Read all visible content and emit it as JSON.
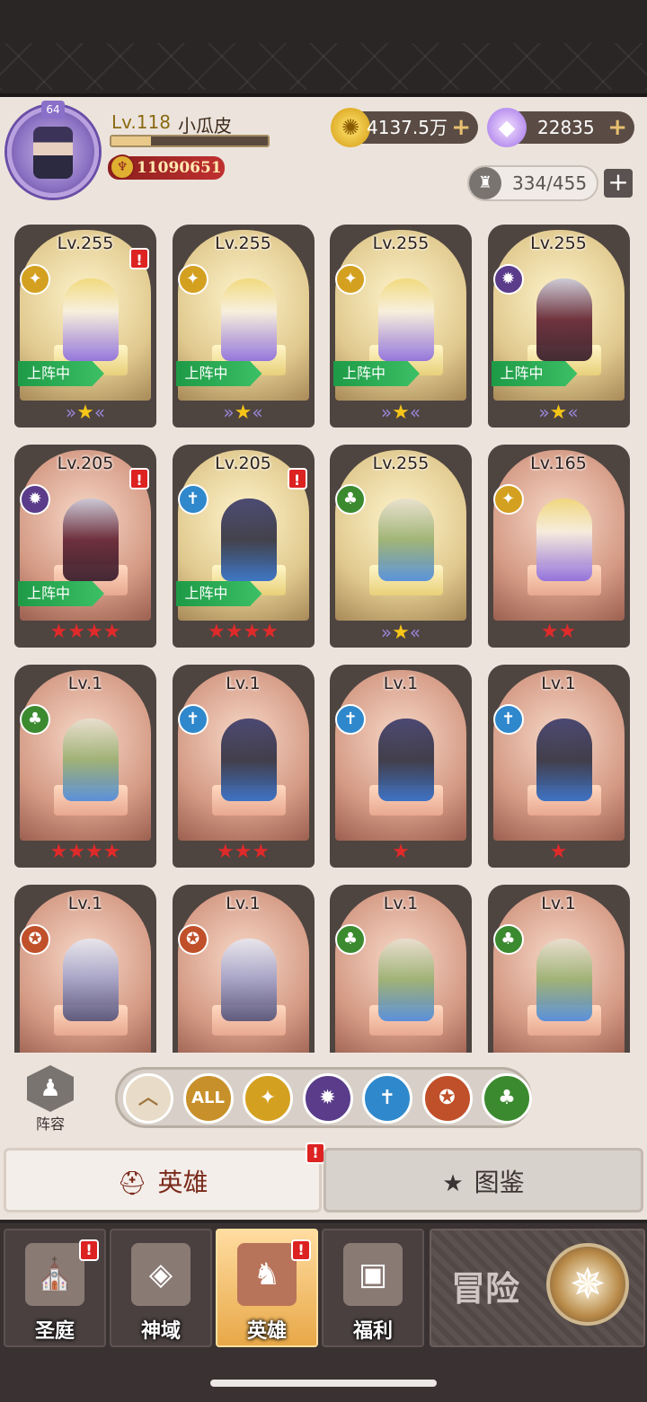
{
  "player": {
    "level_label": "Lv.118",
    "name": "小瓜皮",
    "avatar_level": "64",
    "power": "11090651",
    "xp_fraction": 0.25
  },
  "currency": {
    "gold": "4137.5万",
    "gems": "22835"
  },
  "capacity": "334/455",
  "deploy_label": "上阵中",
  "heroes": [
    {
      "level": "Lv.255",
      "faction": "light",
      "alert": true,
      "deployed": true,
      "stars": 1,
      "star_color": "gold",
      "bg": "gold"
    },
    {
      "level": "Lv.255",
      "faction": "light",
      "alert": false,
      "deployed": true,
      "stars": 1,
      "star_color": "gold",
      "bg": "gold"
    },
    {
      "level": "Lv.255",
      "faction": "light",
      "alert": false,
      "deployed": true,
      "stars": 1,
      "star_color": "gold",
      "bg": "gold"
    },
    {
      "level": "Lv.255",
      "faction": "dark",
      "alert": false,
      "deployed": true,
      "stars": 1,
      "star_color": "gold",
      "bg": "gold"
    },
    {
      "level": "Lv.205",
      "faction": "dark",
      "alert": true,
      "deployed": true,
      "stars": 4,
      "star_color": "red",
      "bg": "copper"
    },
    {
      "level": "Lv.205",
      "faction": "water",
      "alert": true,
      "deployed": true,
      "stars": 4,
      "star_color": "red",
      "bg": "gold"
    },
    {
      "level": "Lv.255",
      "faction": "nature",
      "alert": false,
      "deployed": false,
      "stars": 1,
      "star_color": "gold",
      "bg": "gold"
    },
    {
      "level": "Lv.165",
      "faction": "light",
      "alert": false,
      "deployed": false,
      "stars": 2,
      "star_color": "red",
      "bg": "copper"
    },
    {
      "level": "Lv.1",
      "faction": "nature",
      "alert": false,
      "deployed": false,
      "stars": 4,
      "star_color": "red",
      "bg": "copper"
    },
    {
      "level": "Lv.1",
      "faction": "water",
      "alert": false,
      "deployed": false,
      "stars": 3,
      "star_color": "red",
      "bg": "copper"
    },
    {
      "level": "Lv.1",
      "faction": "water",
      "alert": false,
      "deployed": false,
      "stars": 1,
      "star_color": "red",
      "bg": "copper"
    },
    {
      "level": "Lv.1",
      "faction": "water",
      "alert": false,
      "deployed": false,
      "stars": 1,
      "star_color": "red",
      "bg": "copper"
    },
    {
      "level": "Lv.1",
      "faction": "beast",
      "alert": false,
      "deployed": false,
      "stars": 0,
      "star_color": "red",
      "bg": "copper"
    },
    {
      "level": "Lv.1",
      "faction": "beast",
      "alert": false,
      "deployed": false,
      "stars": 0,
      "star_color": "red",
      "bg": "copper"
    },
    {
      "level": "Lv.1",
      "faction": "nature",
      "alert": false,
      "deployed": false,
      "stars": 0,
      "star_color": "red",
      "bg": "copper"
    },
    {
      "level": "Lv.1",
      "faction": "nature",
      "alert": false,
      "deployed": false,
      "stars": 0,
      "star_color": "red",
      "bg": "copper"
    }
  ],
  "lineup_label": "阵容",
  "filters": [
    {
      "id": "sort",
      "label": "",
      "icon": "chevron-up-icon",
      "color": "#e8dcc8"
    },
    {
      "id": "all",
      "label": "ALL",
      "icon": "",
      "color": "#c8902a"
    },
    {
      "id": "light",
      "label": "",
      "icon": "light-faction-icon",
      "color": "#d4a020"
    },
    {
      "id": "dark",
      "label": "",
      "icon": "dark-faction-icon",
      "color": "#5a3c8a"
    },
    {
      "id": "water",
      "label": "",
      "icon": "water-faction-icon",
      "color": "#2f88cc"
    },
    {
      "id": "beast",
      "label": "",
      "icon": "beast-faction-icon",
      "color": "#c0502a"
    },
    {
      "id": "nature",
      "label": "",
      "icon": "nature-faction-icon",
      "color": "#3c8a30"
    }
  ],
  "tabs": {
    "hero": "英雄",
    "codex": "图鉴"
  },
  "nav": {
    "court": "圣庭",
    "divine": "神域",
    "hero": "英雄",
    "welfare": "福利",
    "adventure": "冒险"
  },
  "alert_mark": "!"
}
